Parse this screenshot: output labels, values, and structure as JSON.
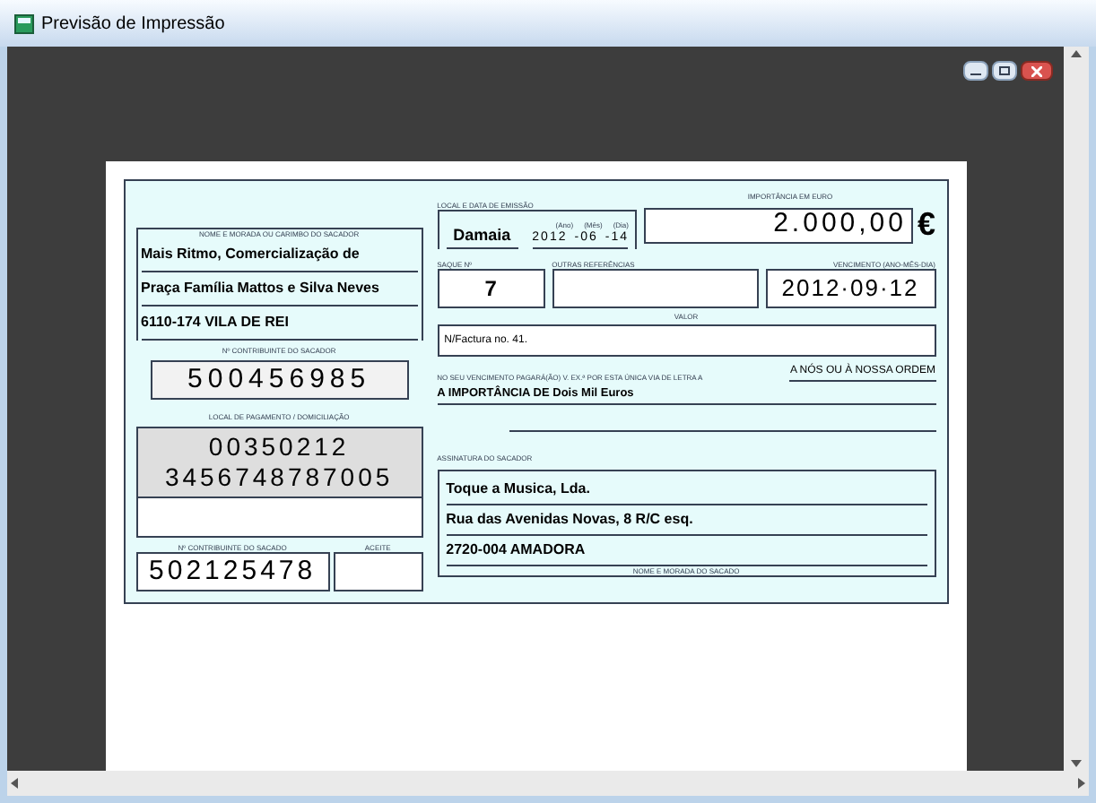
{
  "window": {
    "title": "Previsão de Impressão"
  },
  "letter": {
    "issue": {
      "label": "LOCAL E DATA DE EMISSÃO",
      "place": "Damaia",
      "date_labels": [
        "(Ano)",
        "(Mês)",
        "(Dia)"
      ],
      "year": "2012",
      "month": "-06",
      "day": "-14"
    },
    "amount": {
      "label": "IMPORTÂNCIA EM EURO",
      "value": "2.000,00",
      "currency": "€"
    },
    "drawer": {
      "label": "NOME E MORADA OU CARIMBO DO SACADOR",
      "lines": [
        "Mais Ritmo, Comercialização de",
        "Praça Família Mattos e Silva Neves",
        "6110-174 VILA DE REI"
      ],
      "tax_label": "Nº CONTRIBUINTE DO SACADOR",
      "tax_id": "500456985"
    },
    "draft": {
      "label": "SAQUE Nº",
      "value": "7"
    },
    "other_refs": {
      "label": "OUTRAS REFERÊNCIAS"
    },
    "due": {
      "label": "VENCIMENTO (ANO-MÊS-DIA)",
      "value": "2012·09·12"
    },
    "value": {
      "label": "VALOR",
      "text": "N/Factura no. 41."
    },
    "payment_text": "NO SEU VENCIMENTO PAGARÁ(ÃO) V. EX.ª POR ESTA ÚNICA VIA DE LETRA A",
    "order_text": "A NÓS OU À NOSSA ORDEM",
    "amount_words": "A IMPORTÂNCIA DE Dois Mil Euros",
    "payment_place": {
      "label": "LOCAL DE PAGAMENTO / DOMICILIAÇÃO",
      "lines": [
        "00350212",
        "3456748787005"
      ]
    },
    "drawee_tax": {
      "label": "Nº CONTRIBUINTE DO SACADO",
      "value": "502125478",
      "acceptance_label": "ACEITE"
    },
    "signature_label": "ASSINATURA DO SACADOR",
    "drawee": {
      "lines": [
        "Toque a Musica, Lda.",
        "Rua das Avenidas Novas, 8 R/C esq.",
        "2720-004 AMADORA"
      ],
      "label": "NOME E MORADA DO SACADO"
    }
  }
}
